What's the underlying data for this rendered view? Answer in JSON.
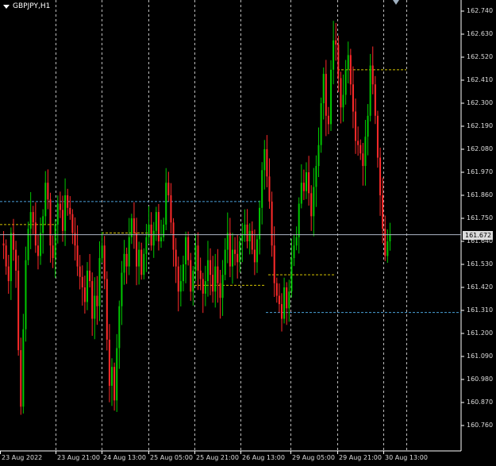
{
  "title": "GBPJPY,H1",
  "chart_data": {
    "type": "candlestick",
    "symbol": "GBPJPY",
    "timeframe": "H1",
    "current_price": "161.672",
    "price_ticks": [
      "162.740",
      "162.630",
      "162.520",
      "162.410",
      "162.300",
      "162.190",
      "162.080",
      "161.970",
      "161.860",
      "161.750",
      "161.640",
      "161.530",
      "161.420",
      "161.310",
      "161.200",
      "161.090",
      "160.980",
      "160.870",
      "160.760"
    ],
    "ylim": [
      160.76,
      162.74
    ],
    "time_ticks": [
      "23 Aug 2022",
      "23 Aug 21:00",
      "24 Aug 13:00",
      "25 Aug 05:00",
      "25 Aug 21:00",
      "26 Aug 13:00",
      "29 Aug 05:00",
      "29 Aug 21:00",
      "30 Aug 13:00"
    ],
    "grid": true,
    "colors": {
      "background": "#000000",
      "up": "#00c800",
      "down": "#ff2a2a",
      "grid": "#bbbbbb",
      "level_yellow": "#d4c200",
      "level_blue": "#4aa0d8",
      "current_line": "#b0b8c8"
    },
    "levels": [
      {
        "price": 161.83,
        "color": "blue",
        "from": "23 Aug 2022",
        "to": "26 Aug 13:00"
      },
      {
        "price": 161.72,
        "color": "yellow",
        "from": "23 Aug 2022",
        "to": "23 Aug 21:00"
      },
      {
        "price": 161.68,
        "color": "yellow",
        "from": "24 Aug 13:00",
        "to": "25 Aug 05:00"
      },
      {
        "price": 161.43,
        "color": "yellow",
        "from": "25 Aug 05:00",
        "to": "26 Aug 13:00"
      },
      {
        "price": 161.48,
        "color": "yellow",
        "from": "26 Aug 13:00",
        "to": "29 Aug 21:00"
      },
      {
        "price": 162.46,
        "color": "yellow",
        "from": "29 Aug 21:00",
        "to": "30 Aug 13:00"
      },
      {
        "price": 161.3,
        "color": "blue",
        "from": "26 Aug 13:00",
        "to": "end"
      }
    ],
    "closes": [
      161.62,
      161.52,
      161.45,
      161.68,
      161.6,
      161.5,
      161.12,
      160.85,
      161.22,
      161.55,
      161.7,
      161.78,
      161.73,
      161.62,
      161.57,
      161.68,
      161.76,
      161.92,
      161.84,
      161.62,
      161.56,
      161.72,
      161.82,
      161.79,
      161.69,
      161.86,
      161.8,
      161.77,
      161.68,
      161.62,
      161.52,
      161.47,
      161.42,
      161.35,
      161.5,
      161.45,
      161.27,
      161.38,
      161.33,
      161.56,
      161.62,
      161.46,
      161.17,
      160.95,
      161.04,
      160.88,
      161.13,
      161.33,
      161.49,
      161.58,
      161.52,
      161.66,
      161.75,
      161.68,
      161.52,
      161.6,
      161.48,
      161.58,
      161.66,
      161.72,
      161.62,
      161.69,
      161.78,
      161.64,
      161.66,
      161.72,
      161.92,
      161.86,
      161.73,
      161.6,
      161.52,
      161.4,
      161.45,
      161.53,
      161.66,
      161.55,
      161.4,
      161.5,
      161.62,
      161.5,
      161.46,
      161.39,
      161.45,
      161.55,
      161.48,
      161.4,
      161.52,
      161.44,
      161.37,
      161.48,
      161.6,
      161.68,
      161.52,
      161.6,
      161.58,
      161.54,
      161.64,
      161.67,
      161.72,
      161.64,
      161.69,
      161.6,
      161.54,
      161.65,
      161.8,
      161.98,
      162.08,
      161.95,
      161.83,
      161.62,
      161.44,
      161.38,
      161.34,
      161.27,
      161.42,
      161.32,
      161.4,
      161.56,
      161.62,
      161.66,
      161.82,
      161.92,
      161.88,
      161.97,
      161.87,
      161.76,
      161.9,
      162.0,
      162.1,
      162.3,
      162.44,
      162.24,
      162.2,
      162.46,
      162.6,
      162.58,
      162.42,
      162.28,
      162.34,
      162.46,
      162.53,
      162.39,
      162.26,
      162.12,
      162.1,
      162.06,
      162.0,
      162.14,
      162.24,
      162.48,
      162.39,
      162.24,
      162.04,
      161.86,
      161.7,
      161.57,
      161.64,
      161.67
    ]
  }
}
